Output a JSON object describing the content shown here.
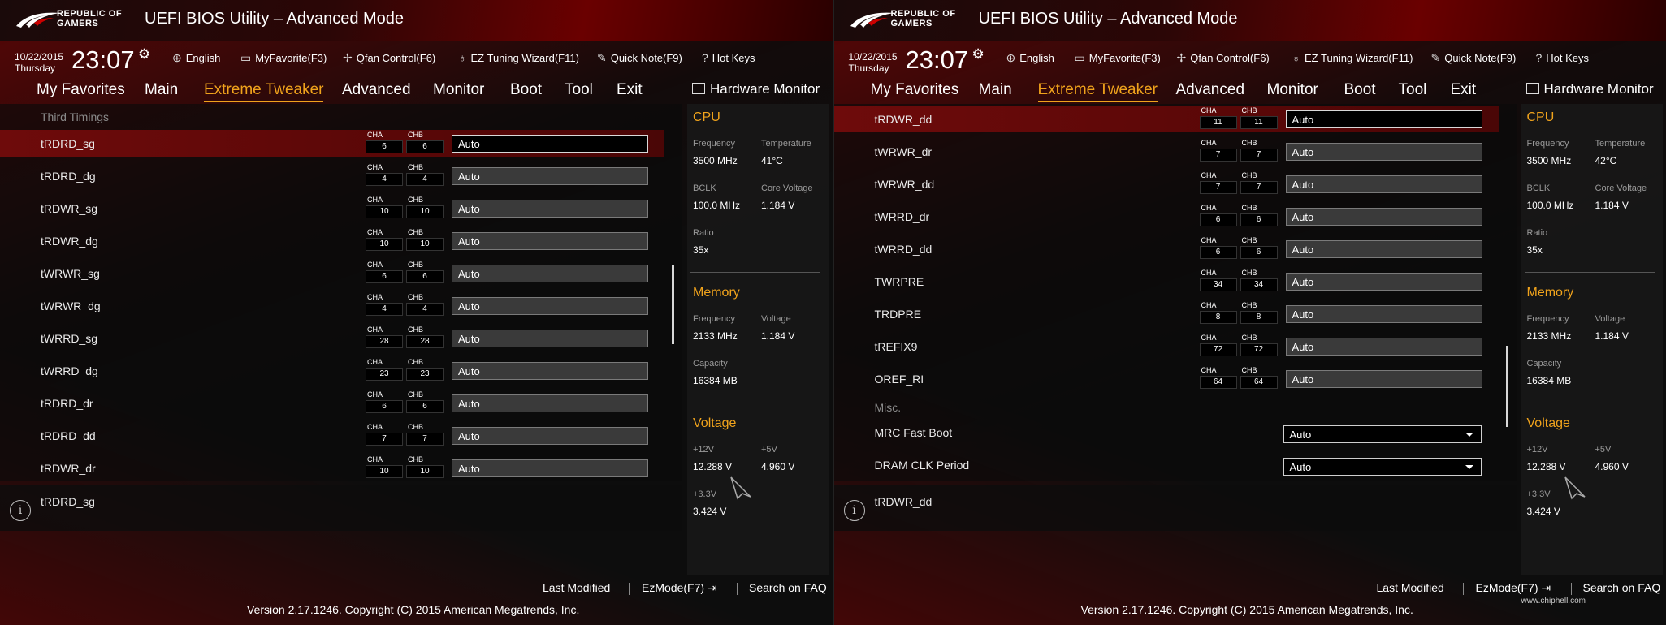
{
  "app_title": "UEFI BIOS Utility – Advanced Mode",
  "logo": {
    "line1": "REPUBLIC OF",
    "line2": "GAMERS"
  },
  "date": "10/22/2015",
  "day": "Thursday",
  "time": "23:07",
  "toolbar": {
    "language": "English",
    "myfavorite": "MyFavorite(F3)",
    "qfan": "Qfan Control(F6)",
    "ez_tuning": "EZ Tuning Wizard(F11)",
    "quick_note": "Quick Note(F9)",
    "hot_keys": "Hot Keys"
  },
  "menu": {
    "favorites": "My Favorites",
    "main": "Main",
    "extreme": "Extreme Tweaker",
    "advanced": "Advanced",
    "monitor": "Monitor",
    "boot": "Boot",
    "tool": "Tool",
    "exit": "Exit"
  },
  "hw_monitor_title": "Hardware Monitor",
  "cha_label": "CHA",
  "chb_label": "CHB",
  "left": {
    "section": "Third Timings",
    "rows": [
      {
        "label": "tRDRD_sg",
        "cha": "6",
        "chb": "6",
        "value": "Auto"
      },
      {
        "label": "tRDRD_dg",
        "cha": "4",
        "chb": "4",
        "value": "Auto"
      },
      {
        "label": "tRDWR_sg",
        "cha": "10",
        "chb": "10",
        "value": "Auto"
      },
      {
        "label": "tRDWR_dg",
        "cha": "10",
        "chb": "10",
        "value": "Auto"
      },
      {
        "label": "tWRWR_sg",
        "cha": "6",
        "chb": "6",
        "value": "Auto"
      },
      {
        "label": "tWRWR_dg",
        "cha": "4",
        "chb": "4",
        "value": "Auto"
      },
      {
        "label": "tWRRD_sg",
        "cha": "28",
        "chb": "28",
        "value": "Auto"
      },
      {
        "label": "tWRRD_dg",
        "cha": "23",
        "chb": "23",
        "value": "Auto"
      },
      {
        "label": "tRDRD_dr",
        "cha": "6",
        "chb": "6",
        "value": "Auto"
      },
      {
        "label": "tRDRD_dd",
        "cha": "7",
        "chb": "7",
        "value": "Auto"
      },
      {
        "label": "tRDWR_dr",
        "cha": "10",
        "chb": "10",
        "value": "Auto"
      }
    ],
    "info": "tRDRD_sg",
    "hw": {
      "cpu_temp": "41°C"
    }
  },
  "right": {
    "rows": [
      {
        "label": "tRDWR_dd",
        "cha": "11",
        "chb": "11",
        "value": "Auto"
      },
      {
        "label": "tWRWR_dr",
        "cha": "7",
        "chb": "7",
        "value": "Auto"
      },
      {
        "label": "tWRWR_dd",
        "cha": "7",
        "chb": "7",
        "value": "Auto"
      },
      {
        "label": "tWRRD_dr",
        "cha": "6",
        "chb": "6",
        "value": "Auto"
      },
      {
        "label": "tWRRD_dd",
        "cha": "6",
        "chb": "6",
        "value": "Auto"
      },
      {
        "label": "TWRPRE",
        "cha": "34",
        "chb": "34",
        "value": "Auto"
      },
      {
        "label": "TRDPRE",
        "cha": "8",
        "chb": "8",
        "value": "Auto"
      },
      {
        "label": "tREFIX9",
        "cha": "72",
        "chb": "72",
        "value": "Auto"
      },
      {
        "label": "OREF_RI",
        "cha": "64",
        "chb": "64",
        "value": "Auto"
      }
    ],
    "section": "Misc.",
    "misc": [
      {
        "label": "MRC Fast Boot",
        "value": "Auto"
      },
      {
        "label": "DRAM CLK Period",
        "value": "Auto"
      }
    ],
    "info": "tRDWR_dd",
    "hw": {
      "cpu_temp": "42°C"
    }
  },
  "hw": {
    "cpu": "CPU",
    "frequency_label": "Frequency",
    "temperature_label": "Temperature",
    "cpu_freq": "3500 MHz",
    "bclk_label": "BCLK",
    "core_voltage_label": "Core Voltage",
    "bclk": "100.0 MHz",
    "core_voltage": "1.184 V",
    "ratio_label": "Ratio",
    "ratio": "35x",
    "memory": "Memory",
    "voltage_label": "Voltage",
    "mem_freq": "2133 MHz",
    "mem_voltage": "1.184 V",
    "capacity_label": "Capacity",
    "capacity": "16384 MB",
    "voltage": "Voltage",
    "v12_label": "+12V",
    "v5_label": "+5V",
    "v12": "12.288 V",
    "v5": "4.960 V",
    "v33_label": "+3.3V",
    "v33": "3.424 V"
  },
  "footer": {
    "last_modified": "Last Modified",
    "ezmode": "EzMode(F7)",
    "search": "Search on FAQ",
    "version": "Version 2.17.1246. Copyright (C) 2015 American Megatrends, Inc."
  },
  "watermark": "www.chiphell.com"
}
